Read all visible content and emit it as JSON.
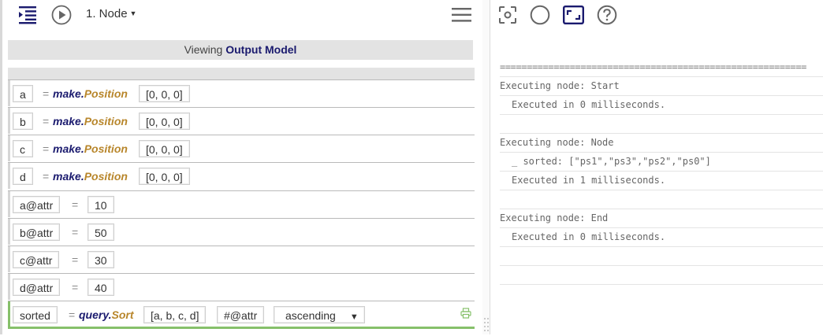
{
  "toolbar": {
    "node_label": "1. Node",
    "icons": [
      "outline-icon",
      "play-icon",
      "menu-icon"
    ]
  },
  "viewing": {
    "prefix": "Viewing",
    "model": "Output Model"
  },
  "procedures": [
    {
      "var": "a",
      "module": "make",
      "func": "Position",
      "arg": "[0, 0, 0]"
    },
    {
      "var": "b",
      "module": "make",
      "func": "Position",
      "arg": "[0, 0, 0]"
    },
    {
      "var": "c",
      "module": "make",
      "func": "Position",
      "arg": "[0, 0, 0]"
    },
    {
      "var": "d",
      "module": "make",
      "func": "Position",
      "arg": "[0, 0, 0]"
    },
    {
      "var": "a@attr",
      "value": "10"
    },
    {
      "var": "b@attr",
      "value": "50"
    },
    {
      "var": "c@attr",
      "value": "30"
    },
    {
      "var": "d@attr",
      "value": "40"
    },
    {
      "var": "sorted",
      "module": "query",
      "func": "Sort",
      "arg1": "[a, b, c, d]",
      "arg2": "#@attr",
      "select": "ascending"
    }
  ],
  "equals": "=",
  "dot": ".",
  "right_toolbar": {
    "icons": [
      "focus-icon",
      "circle-icon",
      "fit-screen-icon",
      "help-icon"
    ]
  },
  "console": {
    "separator": "=========================================================",
    "lines": [
      "Executing node: Start",
      "Executed in 0 milliseconds.",
      "",
      "Executing node: Node",
      "_ sorted: [\"ps1\",\"ps3\",\"ps2\",\"ps0\"]",
      "Executed in 1 milliseconds.",
      "",
      "Executing node: End",
      "Executed in 0 milliseconds.",
      "",
      ""
    ]
  },
  "colors": {
    "module": "#1a1a6e",
    "function": "#b8862b",
    "selected_bar": "#86c06a",
    "toolbar_icon": "#1a1a6e"
  }
}
